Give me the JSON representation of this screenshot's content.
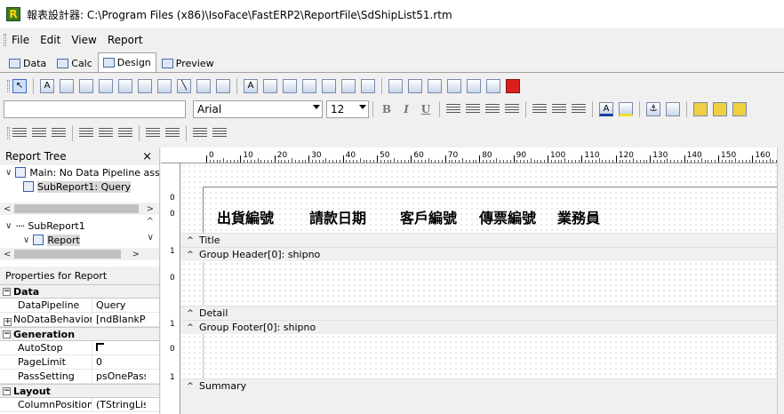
{
  "window": {
    "app_icon": "R",
    "title": "報表設計器: C:\\Program Files (x86)\\IsoFace\\FastERP2\\ReportFile\\SdShipList51.rtm"
  },
  "menu": [
    "File",
    "Edit",
    "View",
    "Report"
  ],
  "tabs": [
    {
      "label": "Data",
      "icon": "data-icon"
    },
    {
      "label": "Calc",
      "icon": "calc-icon"
    },
    {
      "label": "Design",
      "icon": "design-icon",
      "active": true
    },
    {
      "label": "Preview",
      "icon": "preview-icon"
    }
  ],
  "format": {
    "font_name": "Arial",
    "font_size": "12",
    "bold": "B",
    "italic": "I",
    "underline": "U"
  },
  "report_tree": {
    "title": "Report Tree",
    "close": "×",
    "items1": [
      {
        "label": "Main: No Data Pipeline assig"
      },
      {
        "label": "SubReport1: Query"
      }
    ],
    "items2": [
      {
        "label": "SubReport1"
      },
      {
        "label": "Report"
      }
    ]
  },
  "properties": {
    "title": "Properties for Report",
    "groups": [
      {
        "name": "Data",
        "rows": [
          {
            "name": "DataPipeline",
            "value": "Query"
          },
          {
            "name": "NoDataBehaviors",
            "value": "[ndBlankPag"
          }
        ]
      },
      {
        "name": "Generation",
        "rows": [
          {
            "name": "AutoStop",
            "value": ""
          },
          {
            "name": "PageLimit",
            "value": "0"
          },
          {
            "name": "PassSetting",
            "value": "psOnePass"
          }
        ]
      },
      {
        "name": "Layout",
        "rows": [
          {
            "name": "ColumnPositions",
            "value": "(TStringList)"
          }
        ]
      }
    ]
  },
  "ruler": {
    "top_marks": [
      "0",
      "10",
      "20",
      "30",
      "40",
      "50",
      "60",
      "70",
      "80",
      "90",
      "100",
      "110",
      "120",
      "130",
      "140",
      "150",
      "160"
    ],
    "left_marks": [
      "0",
      "0",
      "1",
      "0",
      "1",
      "0",
      "1"
    ]
  },
  "header_labels": [
    "出貨編號",
    "請款日期",
    "客戶編號",
    "傳票編號",
    "業務員"
  ],
  "bands": [
    "Title",
    "Group Header[0]: shipno",
    "Detail",
    "Group Footer[0]: shipno",
    "Summary"
  ]
}
